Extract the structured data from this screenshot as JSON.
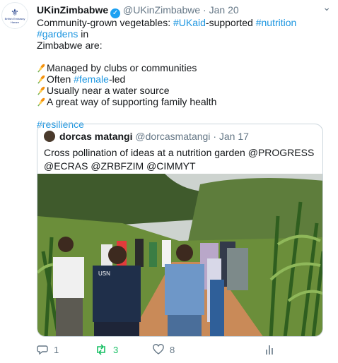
{
  "tweet": {
    "avatar_alt": "British Embassy Harare",
    "display_name": "UKinZimbabwe",
    "handle": "@UKinZimbabwe",
    "separator": "·",
    "date": "Jan 20",
    "more_icon": "chevron-down-icon",
    "line1_a": "Community-grown vegetables: ",
    "hashtag_ukaid": "#UKaid",
    "line1_b": "-supported ",
    "hashtag_nutrition": "#nutrition",
    "hashtag_gardens": "#gardens",
    "line1_c": " in",
    "line2": "Zimbabwe are:",
    "bullet_icon": "sheaf-of-rice-emoji",
    "bullet1": "Managed by clubs or communities",
    "bullet2_a": "Often ",
    "hashtag_female": "#female",
    "bullet2_b": "-led",
    "bullet3": "Usually near a water source",
    "bullet4": "A great way of supporting family health",
    "hashtag_resilience": "#resilience"
  },
  "quoted": {
    "display_name": "dorcas matangi",
    "handle": "@dorcasmatangi",
    "separator": "·",
    "date": "Jan 17",
    "text": "Cross pollination of ideas at a nutrition garden @PROGRESS @ECRAS @ZRBFZIM @CIMMYT",
    "shirt_text": "USN"
  },
  "actions": {
    "reply_count": "1",
    "retweet_count": "3",
    "like_count": "8",
    "colors": {
      "muted": "#657786",
      "retweet": "#17bf63",
      "link": "#1b95e0"
    }
  }
}
